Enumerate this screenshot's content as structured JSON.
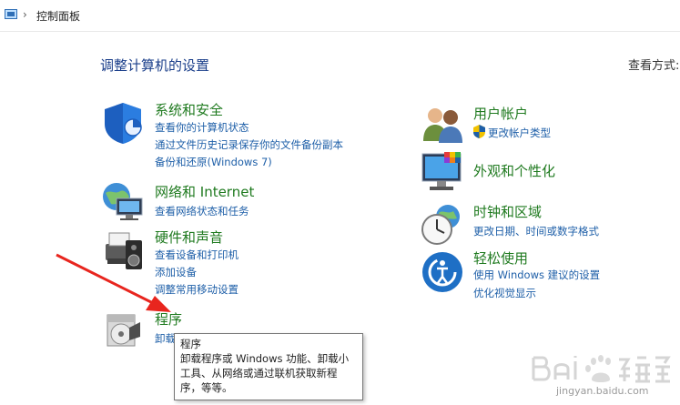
{
  "breadcrumb": {
    "separator": "›",
    "current": "控制面板"
  },
  "main": {
    "title": "调整计算机的设置",
    "view_by_label": "查看方式:"
  },
  "categories_left": [
    {
      "title": "系统和安全",
      "icon": "shield-icon",
      "links": [
        "查看你的计算机状态",
        "通过文件历史记录保存你的文件备份副本",
        "备份和还原(Windows 7)"
      ]
    },
    {
      "title": "网络和 Internet",
      "icon": "network-globe-icon",
      "links": [
        "查看网络状态和任务"
      ]
    },
    {
      "title": "硬件和声音",
      "icon": "printer-speaker-icon",
      "links": [
        "查看设备和打印机",
        "添加设备",
        "调整常用移动设置"
      ]
    },
    {
      "title": "程序",
      "icon": "programs-disc-icon",
      "links": [
        "卸载"
      ]
    }
  ],
  "categories_right": [
    {
      "title": "用户帐户",
      "icon": "users-icon",
      "links": [
        "更改帐户类型"
      ]
    },
    {
      "title": "外观和个性化",
      "icon": "monitor-palette-icon",
      "links": []
    },
    {
      "title": "时钟和区域",
      "icon": "clock-globe-icon",
      "links": [
        "更改日期、时间或数字格式"
      ]
    },
    {
      "title": "轻松使用",
      "icon": "ease-of-access-icon",
      "links": [
        "使用 Windows 建议的设置",
        "优化视觉显示"
      ]
    }
  ],
  "tooltip": {
    "title": "程序",
    "lines": [
      "卸载程序或 Windows 功能、卸载小",
      "工具、从网络或通过联机获取新程",
      "序，等等。"
    ]
  },
  "watermark": {
    "text": "jingyan.baidu.com"
  },
  "colors": {
    "link": "#1e5fa8",
    "category_title": "#1f7a1f",
    "page_title": "#1a3e8a",
    "arrow": "#e8251e"
  }
}
